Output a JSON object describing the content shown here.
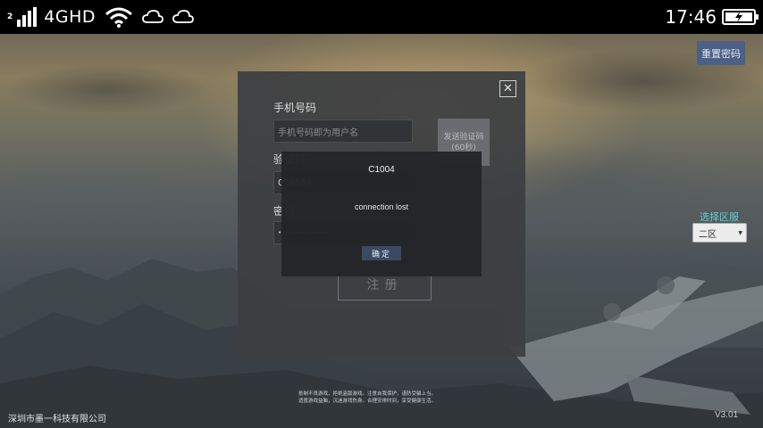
{
  "status_bar": {
    "sim_number": "2",
    "network": "4GHD",
    "time": "17:46"
  },
  "top_right": {
    "reset_password_label": "重置密码"
  },
  "register_panel": {
    "close_label": "✕",
    "phone_label": "手机号码",
    "phone_placeholder": "手机号码即为用户名",
    "code_label": "验证码",
    "code_value": "058584",
    "send_code_label": "发送验证码",
    "send_code_countdown": "(60秒)",
    "password_label": "密码",
    "password_value": "••••••••••••••",
    "register_label": "注册"
  },
  "error_dialog": {
    "title": "C1004",
    "message": "connection lost",
    "ok_label": "确定"
  },
  "server": {
    "label": "选择区服",
    "selected": "二区"
  },
  "footer": {
    "notice_line1": "抵制不良游戏，拒绝盗版游戏。注意自我保护，谨防受骗上当。",
    "notice_line2": "适度游戏益脑，沉迷游戏伤身。合理安排时间，享受健康生活。",
    "company": "深圳市墨一科技有限公司",
    "version": "V3.01"
  },
  "colors": {
    "accent_button": "#4c5f84",
    "server_label": "#5ed1d1",
    "dialog_ok": "#3a4a64"
  }
}
